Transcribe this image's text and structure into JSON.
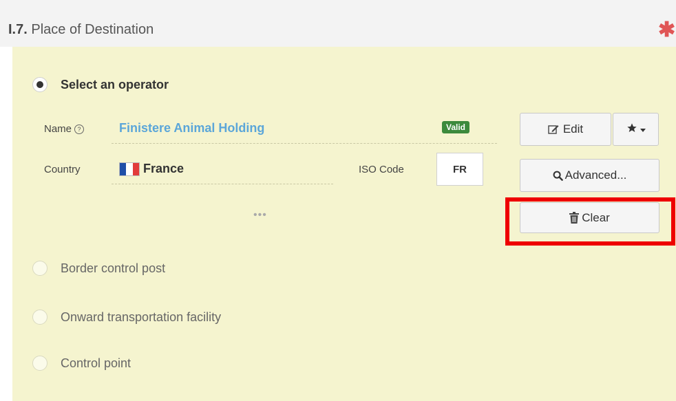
{
  "header": {
    "section_number": "I.7.",
    "title": "Place of Destination",
    "required_mark": "✱"
  },
  "operator_option": {
    "label": "Select an operator",
    "selected": true
  },
  "name_field": {
    "label": "Name",
    "help_icon": "question-circle-icon",
    "value": "Finistere Animal Holding",
    "status_badge": "Valid"
  },
  "country_field": {
    "label": "Country",
    "value": "France",
    "flag_icon": "france-flag-icon",
    "flag_colors": [
      "#1f4fa8",
      "#ffffff",
      "#e23b3b"
    ]
  },
  "iso_field": {
    "label": "ISO Code",
    "value": "FR"
  },
  "more_indicator": "•••",
  "buttons": {
    "edit": {
      "label": "Edit",
      "icon": "edit-icon"
    },
    "favorite": {
      "icon": "star-icon",
      "dropdown_icon": "caret-down-icon"
    },
    "advanced": {
      "label": "Advanced...",
      "icon": "search-icon"
    },
    "clear": {
      "label": "Clear",
      "icon": "trash-icon"
    }
  },
  "other_options": [
    {
      "label": "Border control post",
      "selected": false
    },
    {
      "label": "Onward transportation facility",
      "selected": false
    },
    {
      "label": "Control point",
      "selected": false
    }
  ],
  "colors": {
    "panel_background": "#f5f4cf",
    "link_blue": "#5ba6d9",
    "valid_green": "#3c8a3c",
    "highlight_red": "#ee0000",
    "required_red": "#e05656"
  }
}
